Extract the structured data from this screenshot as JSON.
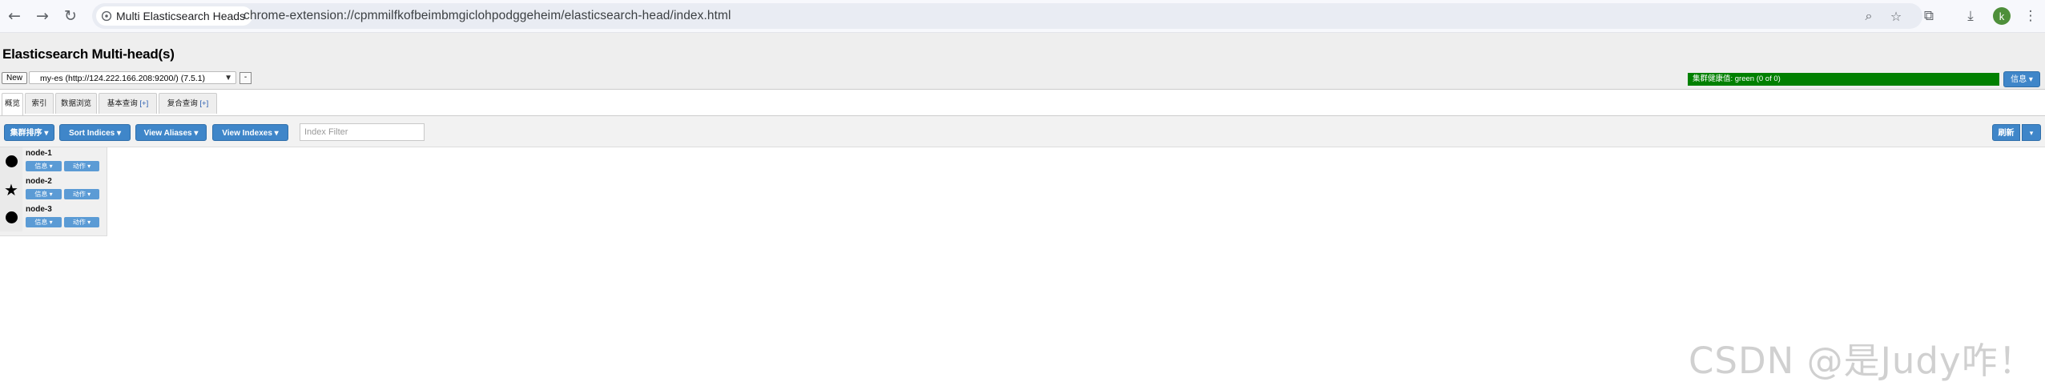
{
  "browser": {
    "tab_title": "Multi Elasticsearch Heads",
    "url": "chrome-extension://cpmmilfkofbeimbmgiclohpodggeheim/elasticsearch-head/index.html",
    "profile_initial": "k"
  },
  "app": {
    "title": "Elasticsearch Multi-head(s)",
    "new_label": "New",
    "cluster_selected": "my-es (http://124.222.166.208:9200/) (7.5.1)",
    "remove_label": "-",
    "health_text": "集群健康值: green (0 of 0)",
    "health_color": "#008000",
    "info_label": "信息 ▾"
  },
  "tabs": [
    {
      "label": "概览"
    },
    {
      "label": "索引"
    },
    {
      "label": "数据浏览"
    },
    {
      "label": "基本查询",
      "plus": "[+]"
    },
    {
      "label": "复合查询",
      "plus": "[+]"
    }
  ],
  "toolbar": {
    "cluster_sort": "集群排序 ▾",
    "sort_indices": "Sort Indices ▾",
    "view_aliases": "View Aliases ▾",
    "view_indexes": "View Indexes ▾",
    "filter_placeholder": "Index Filter",
    "refresh": "刷新",
    "refresh_caret": "▾",
    "accent_color": "#3f86c9"
  },
  "nodes": [
    {
      "name": "node-1",
      "icon": "dot-icon",
      "info": "信息 ▾",
      "action": "动作 ▾"
    },
    {
      "name": "node-2",
      "icon": "star-icon",
      "info": "信息 ▾",
      "action": "动作 ▾"
    },
    {
      "name": "node-3",
      "icon": "dot-icon",
      "info": "信息 ▾",
      "action": "动作 ▾"
    }
  ],
  "watermark": "CSDN @是Judy咋！"
}
